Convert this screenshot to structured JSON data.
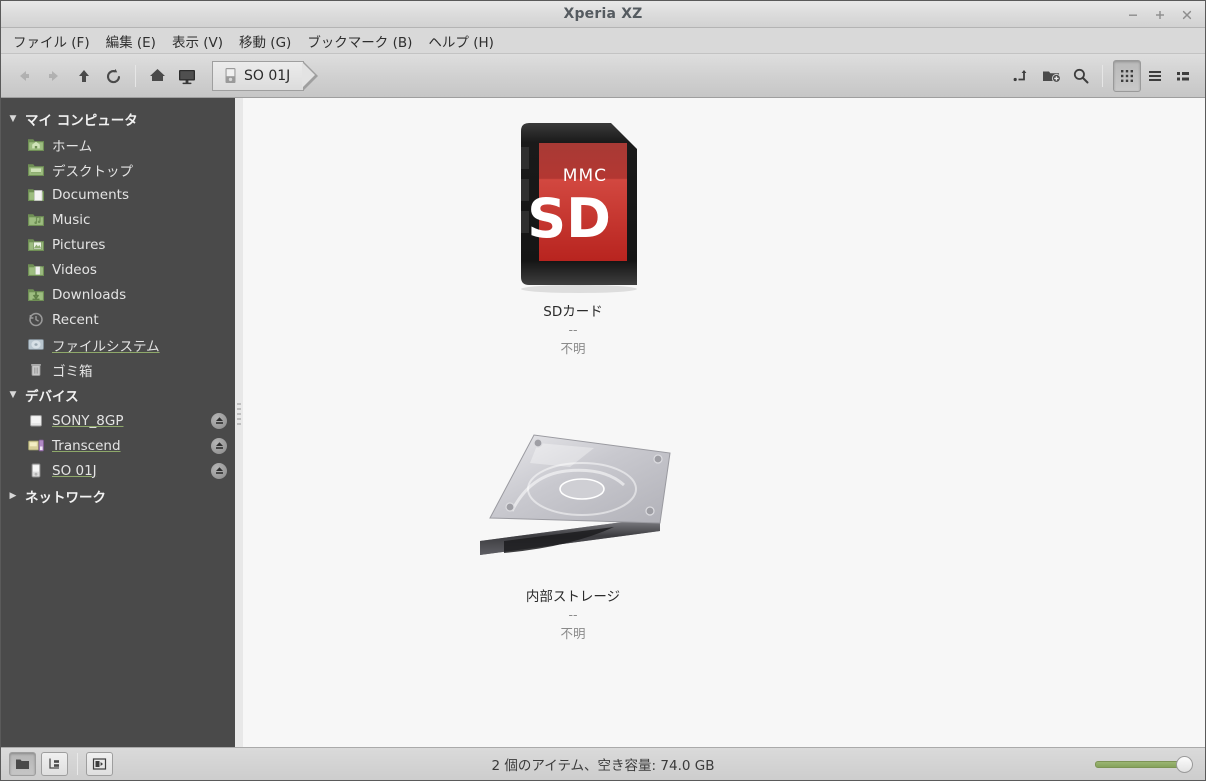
{
  "window": {
    "title": "Xperia XZ",
    "controls": [
      {
        "name": "minimize-button",
        "glyph": "–"
      },
      {
        "name": "maximize-button",
        "glyph": "+"
      },
      {
        "name": "close-button",
        "glyph": "×"
      }
    ]
  },
  "menubar": {
    "items": [
      {
        "label": "ファイル (F)",
        "name": "menu-file"
      },
      {
        "label": "編集 (E)",
        "name": "menu-edit"
      },
      {
        "label": "表示 (V)",
        "name": "menu-view"
      },
      {
        "label": "移動 (G)",
        "name": "menu-go"
      },
      {
        "label": "ブックマーク (B)",
        "name": "menu-bookmarks"
      },
      {
        "label": "ヘルプ (H)",
        "name": "menu-help"
      }
    ]
  },
  "toolbar": {
    "back": "back-icon",
    "forward": "forward-icon",
    "up": "up-icon",
    "reload": "reload-icon",
    "home": "home-icon",
    "computer": "computer-icon",
    "breadcrumb_label": "SO 01J",
    "path_entry": "path-entry-icon",
    "new_folder": "new-folder-icon",
    "search": "search-icon",
    "view_icons": "view-grid-icon",
    "view_list": "view-list-icon",
    "view_compact": "view-compact-icon"
  },
  "sidebar": {
    "sections": [
      {
        "name": "my-computer",
        "label": "マイ コンピュータ",
        "expanded": true,
        "items": [
          {
            "label": "ホーム",
            "icon": "folder-home-icon",
            "name": "sidebar-item-home",
            "linked": false,
            "eject": false
          },
          {
            "label": "デスクトップ",
            "icon": "folder-desktop-icon",
            "name": "sidebar-item-desktop",
            "linked": false,
            "eject": false
          },
          {
            "label": "Documents",
            "icon": "folder-documents-icon",
            "name": "sidebar-item-documents",
            "linked": false,
            "eject": false
          },
          {
            "label": "Music",
            "icon": "folder-music-icon",
            "name": "sidebar-item-music",
            "linked": false,
            "eject": false
          },
          {
            "label": "Pictures",
            "icon": "folder-pictures-icon",
            "name": "sidebar-item-pictures",
            "linked": false,
            "eject": false
          },
          {
            "label": "Videos",
            "icon": "folder-videos-icon",
            "name": "sidebar-item-videos",
            "linked": false,
            "eject": false
          },
          {
            "label": "Downloads",
            "icon": "folder-downloads-icon",
            "name": "sidebar-item-downloads",
            "linked": false,
            "eject": false
          },
          {
            "label": "Recent",
            "icon": "recent-clock-icon",
            "name": "sidebar-item-recent",
            "linked": false,
            "eject": false
          },
          {
            "label": "ファイルシステム",
            "icon": "filesystem-drive-icon",
            "name": "sidebar-item-filesystem",
            "linked": true,
            "eject": false
          },
          {
            "label": "ゴミ箱",
            "icon": "trash-icon",
            "name": "sidebar-item-trash",
            "linked": false,
            "eject": false
          }
        ]
      },
      {
        "name": "devices",
        "label": "デバイス",
        "expanded": true,
        "items": [
          {
            "label": "SONY_8GP",
            "icon": "usb-drive-icon",
            "name": "sidebar-item-sony-8gp",
            "linked": true,
            "eject": true
          },
          {
            "label": "Transcend",
            "icon": "card-reader-icon",
            "name": "sidebar-item-transcend",
            "linked": true,
            "eject": true
          },
          {
            "label": "SO 01J",
            "icon": "phone-icon",
            "name": "sidebar-item-so-01j",
            "linked": true,
            "eject": true
          }
        ]
      },
      {
        "name": "network",
        "label": "ネットワーク",
        "expanded": false,
        "items": []
      }
    ]
  },
  "main": {
    "files": [
      {
        "name": "SDカード",
        "size": "--",
        "type": "不明",
        "icon": "sd-card-icon",
        "icon_text_top": "MMC",
        "icon_text_main": "SD",
        "element_name": "file-item-sd-card"
      },
      {
        "name": "内部ストレージ",
        "size": "--",
        "type": "不明",
        "icon": "hard-drive-icon",
        "icon_text_top": "",
        "icon_text_main": "",
        "element_name": "file-item-internal-storage"
      }
    ]
  },
  "statusbar": {
    "text": "2 個のアイテム、空き容量: 74.0 GB",
    "buttons": [
      {
        "name": "view-mode-icons-button",
        "icon": "folder-icon",
        "active": true
      },
      {
        "name": "view-mode-tree-button",
        "icon": "tree-icon",
        "active": false
      },
      {
        "name": "toggle-sidebar-button",
        "icon": "sidebar-panel-icon",
        "active": false
      }
    ],
    "zoom_percent": 100
  },
  "colors": {
    "sidebar_bg": "#4a4a4a",
    "main_bg": "#f7f7f7",
    "accent_green": "#8ea86a",
    "sd_red": "#c9352f"
  }
}
